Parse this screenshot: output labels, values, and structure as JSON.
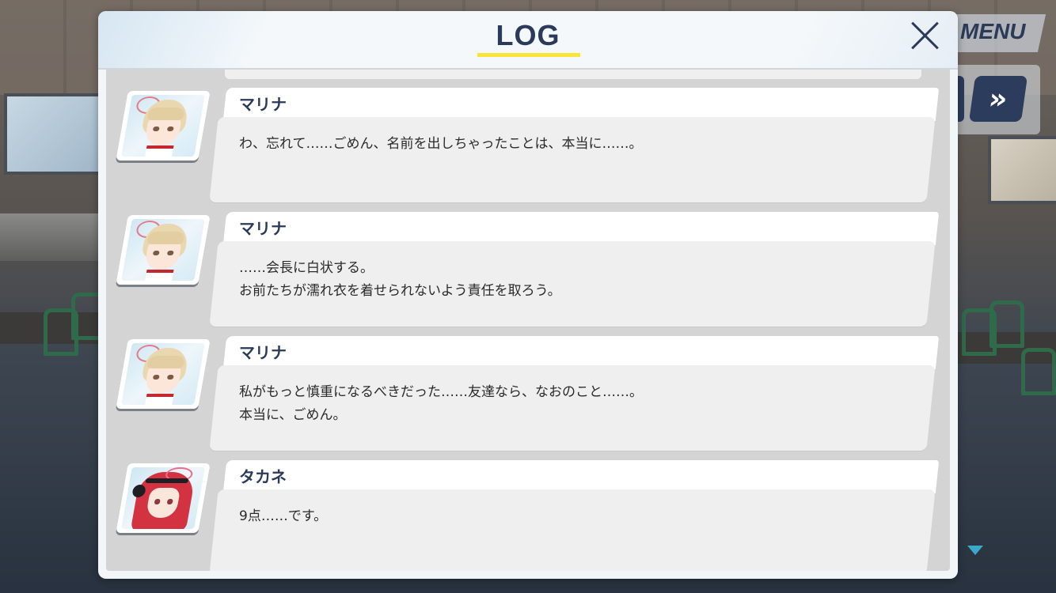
{
  "hud": {
    "menu_label": "MENU",
    "skip_label": "»"
  },
  "log_panel": {
    "title": "LOG",
    "entries": [
      {
        "speaker": "マリナ",
        "portrait": "blonde-student-portrait",
        "lines": [
          "わ、忘れて……ごめん、名前を出しちゃったことは、本当に……。"
        ]
      },
      {
        "speaker": "マリナ",
        "portrait": "blonde-student-portrait",
        "lines": [
          "……会長に白状する。",
          "お前たちが濡れ衣を着せられないよう責任を取ろう。"
        ]
      },
      {
        "speaker": "マリナ",
        "portrait": "blonde-student-portrait",
        "lines": [
          "私がもっと慎重になるべきだった……友達なら、なおのこと……。",
          "本当に、ごめん。"
        ]
      },
      {
        "speaker": "タカネ",
        "portrait": "red-haired-student-portrait",
        "lines": [
          "9点……です。"
        ]
      }
    ]
  },
  "colors": {
    "title_text": "#2a3a58",
    "title_underline": "#f7e53a",
    "skip_button_bg": "#2b3c5c",
    "scroll_indicator": "#3aa9c9"
  }
}
